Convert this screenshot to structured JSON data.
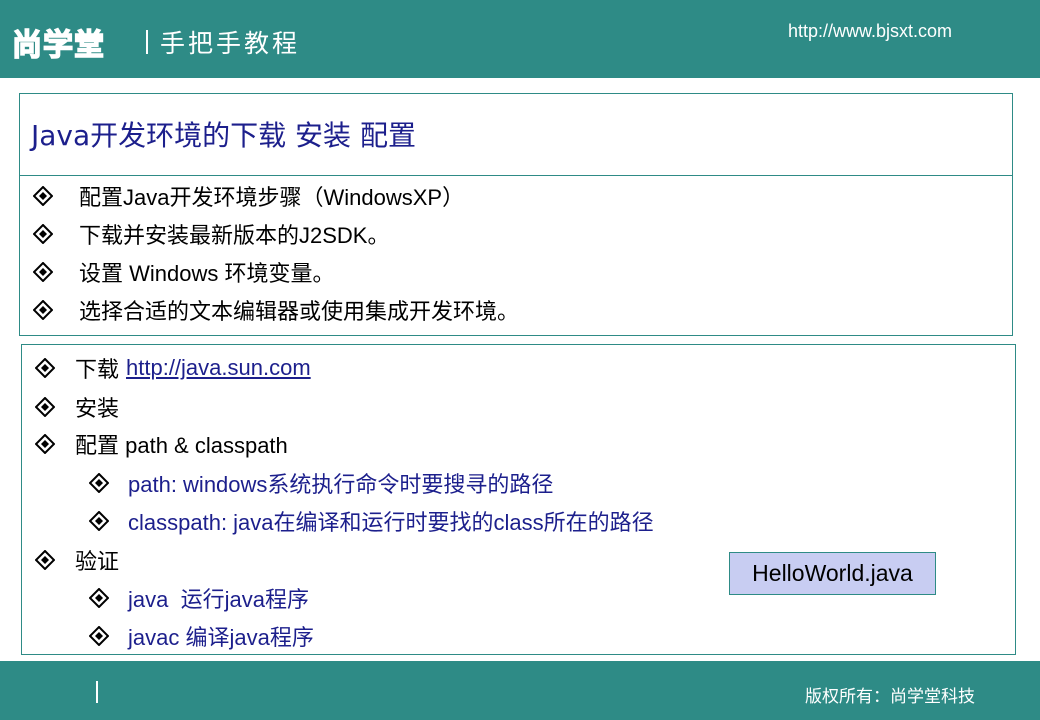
{
  "header": {
    "logo_text": "尚学堂",
    "tagline": "手把手教程",
    "url": "http://www.bjsxt.com"
  },
  "slide": {
    "title": "Java开发环境的下载 安装 配置",
    "steps": [
      "配置Java开发环境步骤（WindowsXP）",
      "下载并安装最新版本的J2SDK。",
      "设置 Windows 环境变量。",
      "选择合适的文本编辑器或使用集成开发环境。"
    ],
    "details": {
      "download_label": "下载 ",
      "download_link": "http://java.sun.com",
      "install_label": "安装",
      "config_label": "配置 path & classpath",
      "config_items": [
        "path: windows系统执行命令时要搜寻的路径",
        "classpath: java在编译和运行时要找的class所在的路径"
      ],
      "verify_label": "验证",
      "verify_items": [
        "java  运行java程序",
        "javac 编译java程序"
      ]
    },
    "note": "HelloWorld.java"
  },
  "footer": {
    "copyright": "版权所有：尚学堂科技"
  },
  "colors": {
    "teal": "#2e8b86",
    "navy": "#1c1f8c",
    "note_bg": "#c8cdf2"
  },
  "icons": [
    "diamond-bullet-icon"
  ]
}
